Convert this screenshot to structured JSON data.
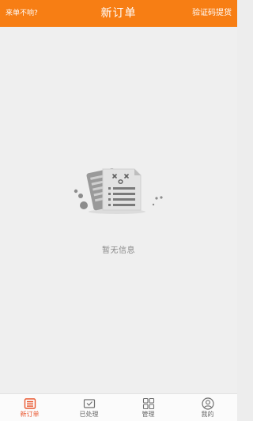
{
  "header": {
    "left_link": "来单不响?",
    "title": "新订单",
    "right_link": "验证码提货"
  },
  "empty_state": {
    "icon": "empty-document-icon",
    "message": "暂无信息"
  },
  "tabs": [
    {
      "label": "新订单",
      "icon": "order-list-icon",
      "active": true
    },
    {
      "label": "已处理",
      "icon": "mail-check-icon",
      "active": false
    },
    {
      "label": "管理",
      "icon": "grid-icon",
      "active": false
    },
    {
      "label": "我的",
      "icon": "user-icon",
      "active": false
    }
  ],
  "colors": {
    "brand": "#f77e14",
    "active_tab": "#e9572f",
    "background": "#efefef"
  }
}
